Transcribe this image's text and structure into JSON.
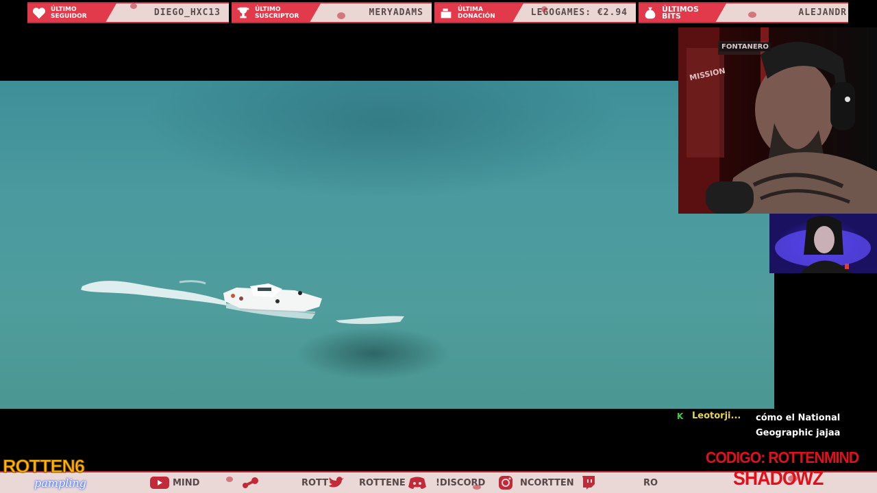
{
  "top_bar": {
    "items": [
      {
        "label": "Último seguidor",
        "value": "DIEGO_HXC13",
        "icon": "heart-icon"
      },
      {
        "label": "Último suscriptor",
        "value": "MERYADAMS",
        "icon": "trophy-icon"
      },
      {
        "label": "Última donación",
        "value": "LEGOGAMES: €2.94",
        "icon": "cash-register-icon"
      },
      {
        "label": "Últimos bits",
        "value": "ALEJANDR",
        "icon": "money-bag-icon"
      }
    ]
  },
  "webcam": {
    "sign_text": "FONTANERO",
    "poster_text": "MISSION"
  },
  "chat": {
    "messages": [
      {
        "badge": "K",
        "user": "Leotorji...",
        "text": "cómo el National Geographic jajaa"
      }
    ]
  },
  "promo": {
    "line1": "CODIGO: ROTTENMIND",
    "line2": "SHADOWZ"
  },
  "logo": {
    "main": "ROTTEN6",
    "sub": "pampling"
  },
  "bottom_bar": {
    "items": [
      {
        "icon": "youtube-icon",
        "text": "MIND"
      },
      {
        "icon": "steam-icon",
        "text": "ROTT"
      },
      {
        "icon": "twitter-icon",
        "text": "ROTTENE"
      },
      {
        "icon": "discord-icon",
        "text": "!DISCORD"
      },
      {
        "icon": "instagram-icon",
        "text": "NCORTTEN"
      },
      {
        "icon": "twitch-icon",
        "text": "RO"
      }
    ]
  },
  "colors": {
    "accent": "#e23a4b",
    "chat_user": "#e4d84a",
    "promo": "#e0101c",
    "logo": "#ffb400"
  }
}
